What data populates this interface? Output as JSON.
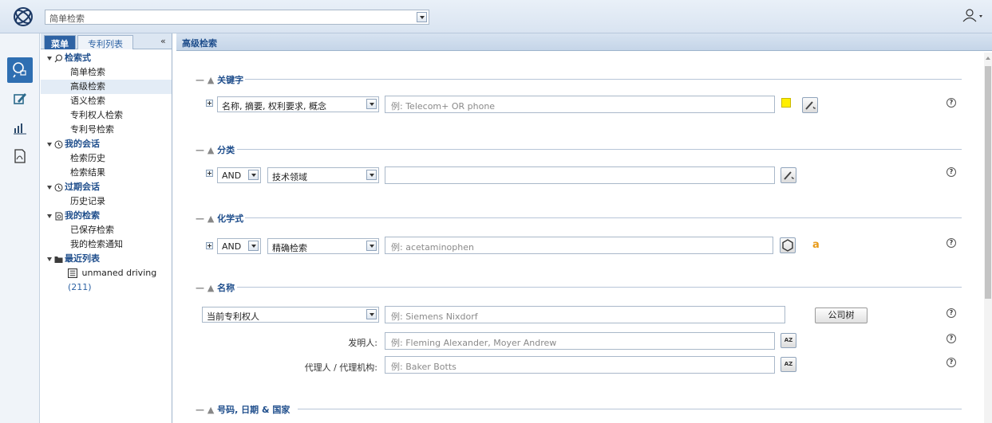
{
  "topbar": {
    "quick_search_value": "简单检索"
  },
  "nav": {
    "tabs": [
      "菜单",
      "专利列表"
    ],
    "collapse": "«",
    "tree": [
      {
        "type": "head",
        "label": "检索式",
        "icon": "search-icon"
      },
      {
        "type": "item",
        "label": "简单检索"
      },
      {
        "type": "item",
        "label": "高级检索",
        "selected": true
      },
      {
        "type": "item",
        "label": "语义检索"
      },
      {
        "type": "item",
        "label": "专利权人检索"
      },
      {
        "type": "item",
        "label": "专利号检索"
      },
      {
        "type": "head",
        "label": "我的会话",
        "icon": "clock-icon"
      },
      {
        "type": "item",
        "label": "检索历史"
      },
      {
        "type": "item",
        "label": "检索结果"
      },
      {
        "type": "head",
        "label": "过期会话",
        "icon": "clock-icon"
      },
      {
        "type": "item",
        "label": "历史记录"
      },
      {
        "type": "head",
        "label": "我的检索",
        "icon": "saved-search-icon"
      },
      {
        "type": "item",
        "label": "已保存检索"
      },
      {
        "type": "item",
        "label": "我的检索通知"
      },
      {
        "type": "head",
        "label": "最近列表",
        "icon": "folder-icon"
      },
      {
        "type": "list",
        "label": "unmaned driving",
        "count": "(211)"
      }
    ]
  },
  "main": {
    "title": "高级检索",
    "sections": {
      "keywords": {
        "label": "关键字",
        "field_select": "名称, 摘要, 权利要求, 概念",
        "placeholder": "例: Telecom+ OR phone"
      },
      "classification": {
        "label": "分类",
        "operator": "AND",
        "field_select": "技术领域",
        "placeholder": ""
      },
      "chemistry": {
        "label": "化学式",
        "operator": "AND",
        "field_select": "精确检索",
        "placeholder": "例: acetaminophen",
        "link": "a"
      },
      "names": {
        "label": "名称",
        "assignee_select": "当前专利权人",
        "assignee_placeholder": "例: Siemens Nixdorf",
        "company_tree_button": "公司树",
        "inventor_label": "发明人:",
        "inventor_placeholder": "例: Fleming Alexander, Moyer Andrew",
        "agent_label": "代理人 / 代理机构:",
        "agent_placeholder": "例: Baker Botts"
      },
      "numbers": {
        "label": "号码, 日期 & 国家"
      }
    },
    "help_glyph": "?",
    "az_glyph": "AZ"
  },
  "colors": {
    "accent": "#2e63a4",
    "highlight": "#ffef00",
    "link": "#e89b1a"
  }
}
